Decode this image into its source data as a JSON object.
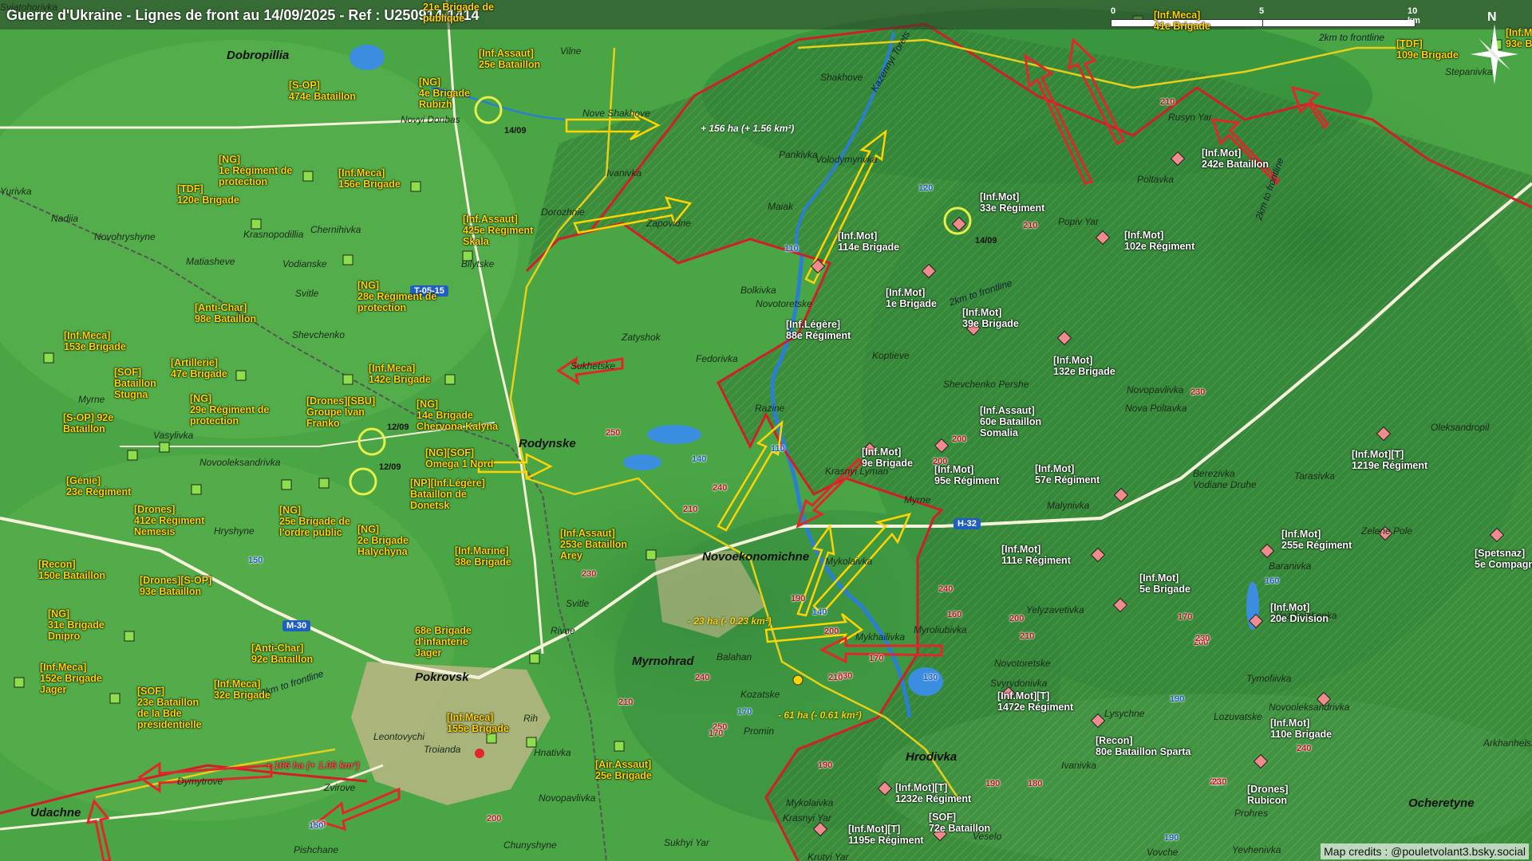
{
  "title": "Guerre d'Ukraine - Lignes de front au 14/09/2025 - Ref : U250914-1414",
  "credit": "Map credits : @pouletvolant3.bsky.social",
  "scale": {
    "zero": "0",
    "mid": "5",
    "end": "10 km"
  },
  "north": "N",
  "colors": {
    "ua": "#ffd400",
    "ru": "#e0282b",
    "front": "#d21f27",
    "terrain": "#3f9a3c"
  },
  "icons": [
    "compass-rose-icon",
    "unit-square-icon",
    "unit-diamond-icon",
    "attack-arrow-icon",
    "strike-circle-icon",
    "town-marker-icon"
  ],
  "areas": [
    {
      "text": "+ 156 ha (+ 1.56 km²)",
      "color": "#fff"
    },
    {
      "text": "- 23 ha (- 0.23 km²)",
      "color": "#ffd400"
    },
    {
      "text": "- 61 ha (- 0.61 km²)",
      "color": "#ffd400"
    },
    {
      "text": "+ 106 ha (+ 1.06 km²)",
      "color": "#ff4a4a"
    }
  ],
  "towns": [
    "Dobropillia",
    "Rodynske",
    "Novoekonomichne",
    "Myrnohrad",
    "Pokrovsk",
    "Udachne",
    "Hrodivka",
    "Ocheretyne"
  ],
  "places": [
    "Sviatohorivka",
    "Vilne",
    "Novyi Donbas",
    "Nove Shakhove",
    "Shakhove",
    "Ivanivka",
    "Dorozhnie",
    "Zapovidne",
    "Pankivka",
    "Volodymyrivka",
    "Maiak",
    "Rusyn Yar",
    "Poltavka",
    "Popiv Yar",
    "Stepanivka",
    "Yurivka",
    "Nadiia",
    "Novohryshyne",
    "Krasnopodillia",
    "Chernihivka",
    "Matiasheve",
    "Vodianske",
    "Bilytske",
    "Svitle",
    "Shevchenko",
    "Myrne",
    "Vasylivka",
    "Novooleksandrivka",
    "Hryshyne",
    "Zatyshok",
    "Sukhetske",
    "Fedorivka",
    "Bolkivka",
    "Novotoretske",
    "Koptieve",
    "Razine",
    "Shevchenko Pershe",
    "Nova Poltavka",
    "Novopavlivka",
    "Oleksandropil",
    "Krasnyi Lyman",
    "Myrne",
    "Malynivka",
    "Berezivka",
    "Vodiane Druhe",
    "Tarasivka",
    "Zelene Pole",
    "Mykolaivka",
    "Svitle",
    "Rivne",
    "Balahan",
    "Kozatske",
    "Promin",
    "Mykhailivka",
    "Myroliubivka",
    "Yelyzavetivka",
    "Baranivka",
    "Vozdvyzhenka",
    "Novotoretske",
    "Svyrydonivka",
    "Tymofiivka",
    "Novooleksandrivka",
    "Lysychne",
    "Lozuvatske",
    "Ivanivka",
    "Arkhanhelske",
    "Leontovychi",
    "Troianda",
    "Rih",
    "Hnativka",
    "Dymytrove",
    "Zvirove",
    "Novopavlivka",
    "Mykolaivka",
    "Krasnyi Yar",
    "Veselo",
    "Prohres",
    "Chunyshyne",
    "Pishchane",
    "Sukhyi Yar",
    "Krutyi Yar",
    "Vovche",
    "Yevhenivka"
  ],
  "roads_red": [
    "210",
    "210",
    "250",
    "240",
    "210",
    "230",
    "230",
    "190",
    "240",
    "210",
    "250",
    "200",
    "200",
    "170",
    "200",
    "200",
    "240",
    "210",
    "230",
    "230",
    "240",
    "210",
    "200",
    "170",
    "190",
    "170",
    "160",
    "210",
    "230",
    "180",
    "190",
    "200",
    "150"
  ],
  "roads_blue": [
    "110",
    "110",
    "120",
    "140",
    "130",
    "140",
    "150",
    "160",
    "170",
    "190",
    "190",
    "150"
  ],
  "highways": [
    "T-05-15",
    "H-32",
    "M-30"
  ],
  "frontline_labels": [
    "2km to frontline",
    "2km to frontline",
    "2km to frontline",
    "2km to frontline",
    "Kazennyi Torets"
  ],
  "units_ua": [
    "21e Brigade de\npublique",
    "[Inf.Assaut]\n25e Bataillon",
    "[S-OP]\n474e Bataillon",
    "[NG]\n4e Brigade\nRubizh",
    "[NG]\n1e Régiment de\nprotection",
    "[Inf.Meca]\n156e Brigade",
    "[TDF]\n120e Brigade",
    "[Inf.Assaut]\n425e Régiment\nSkala",
    "[NG]\n28e Régiment de\nprotection",
    "[Anti-Char]\n98e Bataillon",
    "[Inf.Meca]\n153e Brigade",
    "[Artillerie]\n47e Brigade",
    "[SOF]\nBataillon\nStugna",
    "[Inf.Meca]\n142e Brigade",
    "[NG]\n29e Régiment de\nprotection",
    "[Drones][SBU]\nGroupe Ivan\nFranko",
    "[S-OP] 92e\nBataillon",
    "[NG]\n14e Brigade\nChervona Kalyna",
    "[NG][SOF]\nOmega 1 Nord",
    "[NP][Inf.Légère]\nBataillon de\nDonetsk",
    "[Génie]\n23e Régiment",
    "[Drones]\n412e Régiment\nNemesis",
    "[NG]\n25e Brigade de\nl'ordre public",
    "[NG]\n2e Brigade\nHalychyna",
    "[Recon]\n150e Bataillon",
    "[Drones][S-OP]\n93e Bataillon",
    "[NG]\n31e Brigade\nDnipro",
    "[Inf.Assaut]\n253e Bataillon\nArey",
    "[Inf.Marine]\n38e Brigade",
    "[Anti-Char]\n92e Bataillon",
    "68e Brigade\nd'infanterie\nJager",
    "[Inf.Meca]\n152e Brigade\nJager",
    "[SOF]\n23e Bataillon\nde la Bde\nprésidentielle",
    "[Inf.Meca]\n32e Brigade",
    "[Inf.Meca]\n155e Brigade",
    "[Air.Assaut]\n25e Brigade",
    "[Inf.Meca]\n41e Brigade",
    "[TDF]\n109e Brigade",
    "[Inf.M\n93e B"
  ],
  "units_ru": [
    "[Inf.Mot]\n242e Bataillon",
    "[Inf.Mot]\n33e Régiment",
    "[Inf.Mot]\n102e Régiment",
    "[Inf.Mot]\n114e Brigade",
    "[Inf.Mot]\n1e Brigade",
    "[Inf.Mot]\n39e Brigade",
    "[Inf.Légère]\n88e Régiment",
    "[Inf.Mot]\n132e Brigade",
    "[Inf.Assaut]\n60e Bataillon\nSomalia",
    "[Inf.Mot]\n9e Brigade",
    "[Inf.Mot]\n95e Régiment",
    "[Inf.Mot]\n57e Régiment",
    "[Inf.Mot][T]\n1219e Régiment",
    "[Inf.Mot]\n111e Régiment",
    "[Inf.Mot]\n255e Régiment",
    "[Spetsnaz]\n5e Compagnie",
    "[Inf.Mot]\n5e Brigade",
    "[Inf.Mot]\n20e Division",
    "[Inf.Mot][T]\n1472e Régiment",
    "[Recon]\n80e Bataillon Sparta",
    "[Inf.Mot]\n110e Brigade",
    "[Inf.Mot][T]\n1232e Régiment",
    "[SOF]\n72e Bataillon",
    "[Inf.Mot][T]\n1195e Régiment",
    "[Drones]\nRubicon"
  ],
  "strike_dates": [
    "14/09",
    "14/09",
    "12/09",
    "12/09"
  ]
}
